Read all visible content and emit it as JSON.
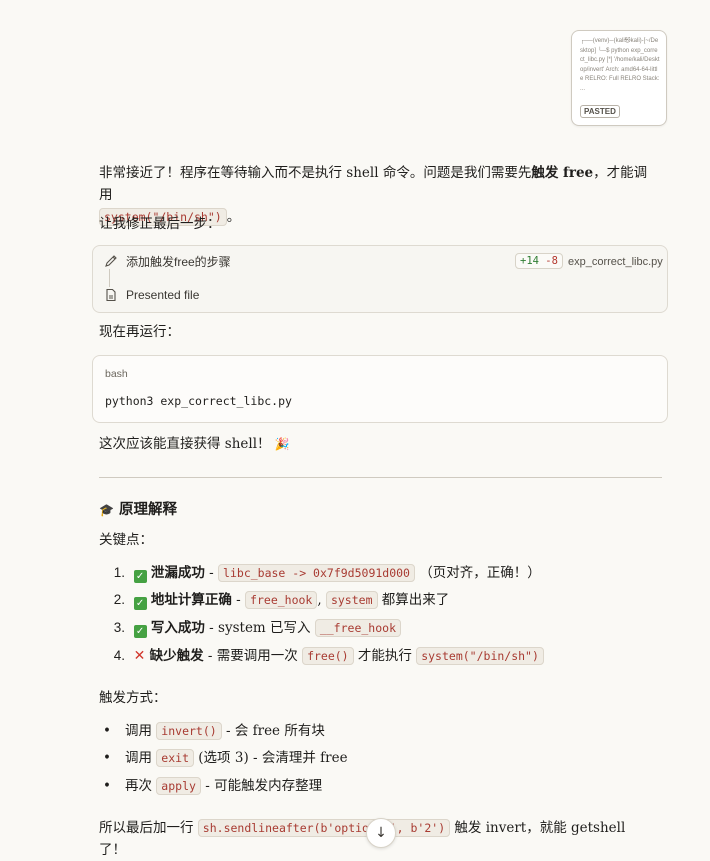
{
  "pasted": {
    "preview": "┌──(venv)─(kali㉿kali)-[~/Desktop] └─$ python exp_correct_libc.py [*] '/home/kali/Desktop/invert' Arch: amd64-64-little RELRO: Full RELRO Stack: ...",
    "badge": "PASTED"
  },
  "msg1": {
    "part1": "非常接近了！程序在等待输入而不是执行 shell 命令。问题是我们需要先",
    "bold": "触发 free",
    "part2": "，才能调用",
    "code": "system(\"/bin/sh\")",
    "end": "。"
  },
  "msg2": "让我修正最后一步：",
  "tool": {
    "edit_label": "添加触发free的步骤",
    "diff_add": "+14",
    "diff_del": "-8",
    "filename": "exp_correct_libc.py",
    "presented_label": "Presented file"
  },
  "msg3": "现在再运行：",
  "codeblock": {
    "lang": "bash",
    "line": "python3 exp_correct_libc.py"
  },
  "msg4": {
    "text": "这次应该能直接获得 shell！",
    "emoji": "🎉"
  },
  "section": {
    "icon": "🎓",
    "title": "原理解释"
  },
  "key_points_label": "关键点：",
  "key_points": [
    {
      "num": "1.",
      "status": "check",
      "bold": "泄漏成功",
      "sep": " - ",
      "code1": "libc_base -> 0x7f9d5091d000",
      "mid": "",
      "code2": "",
      "tail": " （页对齐，正确！）"
    },
    {
      "num": "2.",
      "status": "check",
      "bold": "地址计算正确",
      "sep": " - ",
      "code1": "free_hook",
      "mid": ", ",
      "code2": "system",
      "tail": " 都算出来了"
    },
    {
      "num": "3.",
      "status": "check",
      "bold": "写入成功",
      "sep": " - system 已写入 ",
      "code1": "__free_hook",
      "mid": "",
      "code2": "",
      "tail": ""
    },
    {
      "num": "4.",
      "status": "cross",
      "bold": "缺少触发",
      "sep": " - 需要调用一次 ",
      "code1": "free()",
      "mid": " 才能执行 ",
      "code2": "system(\"/bin/sh\")",
      "tail": ""
    }
  ],
  "trigger_label": "触发方式：",
  "triggers": [
    {
      "pre": "调用 ",
      "code": "invert()",
      "post": " - 会 free 所有块"
    },
    {
      "pre": "调用 ",
      "code": "exit",
      "post": " (选项 3) - 会清理并 free"
    },
    {
      "pre": "再次 ",
      "code": "apply",
      "post": " - 可能触发内存整理"
    }
  ],
  "final": {
    "pre": "所以最后加一行 ",
    "code": "sh.sendlineafter(b'option: ', b'2')",
    "post": " 触发 invert，就能 getshell",
    "wrap": "了！"
  },
  "scroll_icon": "↓"
}
